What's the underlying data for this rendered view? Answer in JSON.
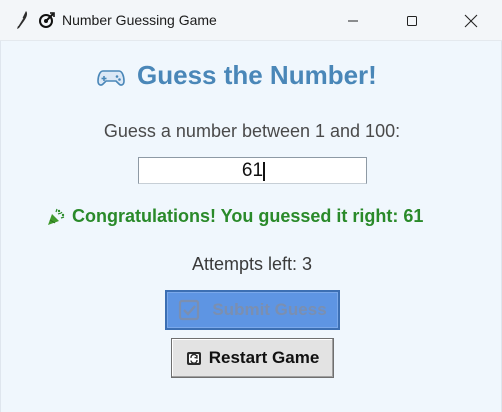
{
  "window": {
    "title": "Number Guessing Game",
    "icons": {
      "app": "feather-icon",
      "title": "target-arrow-icon",
      "minimize": "minimize-icon",
      "maximize": "maximize-icon",
      "close": "close-icon"
    }
  },
  "game": {
    "heading": "Guess the Number!",
    "heading_icon": "game-controller-icon",
    "prompt": "Guess a number between 1 and 100:",
    "guess_value": "61",
    "result_icon": "party-popper-icon",
    "result_message": "Congratulations! You guessed it right: 61",
    "attempts_label": "Attempts left: 3",
    "submit_label": "Submit Guess",
    "submit_icon": "check-box-icon",
    "restart_label": "Restart Game",
    "restart_icon": "restart-icon"
  },
  "colors": {
    "background": "#f0f7fd",
    "heading": "#4a87b8",
    "success": "#2a8a2a",
    "submit_button": "#5e95e3",
    "restart_button": "#e3e3e3"
  }
}
